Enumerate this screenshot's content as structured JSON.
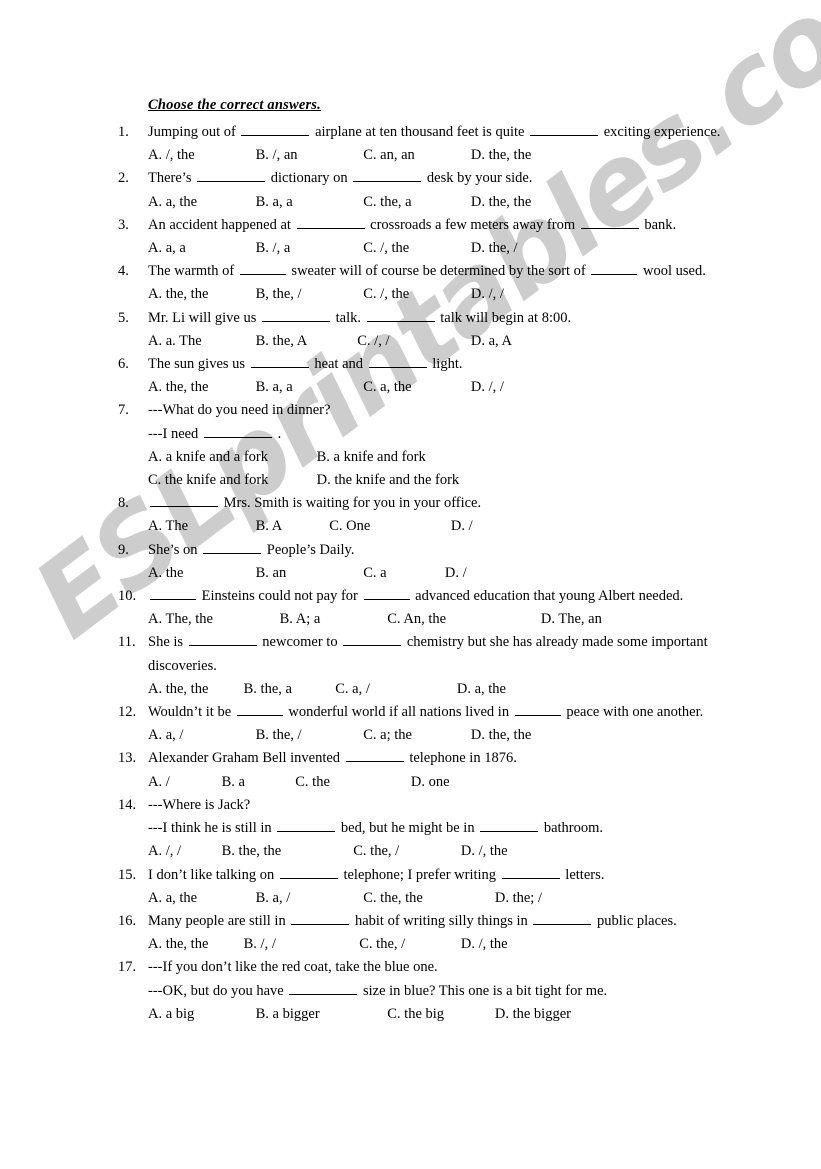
{
  "watermark": {
    "text": "ESLprintables.com",
    "color": "#c9c9c9"
  },
  "worksheet": {
    "title": "Choose the correct answers.",
    "questions": [
      {
        "num": "1.",
        "lines": [
          "Jumping out of",
          "airplane at ten thousand feet is quite",
          "exciting experience."
        ],
        "options": [
          "A. /, the",
          "B. /, an",
          "C. an, an",
          "D. the, the"
        ]
      },
      {
        "num": "2.",
        "lines": [
          "There’s",
          "dictionary on",
          "desk by your side."
        ],
        "options": [
          "A. a, the",
          "B. a, a",
          "C. the, a",
          "D. the, the"
        ]
      },
      {
        "num": "3.",
        "lines": [
          "An accident happened at",
          "crossroads a few meters away from",
          "bank."
        ],
        "options": [
          "A. a, a",
          "B. /, a",
          "C. /, the",
          "D. the, /"
        ]
      },
      {
        "num": "4.",
        "lines": [
          "The warmth of",
          "sweater will of course be determined by the sort of",
          "wool used."
        ],
        "options": [
          "A. the, the",
          "B, the, /",
          "C. /, the",
          "D. /, /"
        ]
      },
      {
        "num": "5.",
        "lines": [
          "Mr. Li will give us",
          "talk.",
          "talk will begin at 8:00."
        ],
        "options": [
          "A. a. The",
          "B. the, A",
          "C. /, /",
          "D. a, A"
        ]
      },
      {
        "num": "6.",
        "lines": [
          "The sun gives us",
          "heat and",
          "light."
        ],
        "options": [
          "A. the, the",
          "B. a, a",
          "C. a, the",
          "D. /, /"
        ]
      },
      {
        "num": "7.",
        "dialogue_1": "---What do you need in dinner?",
        "dialogue_2_pre": "---I need",
        "dialogue_2_post": ".",
        "options_row1": [
          "A. a knife and a fork",
          "B. a knife and fork"
        ],
        "options_row2": [
          "C. the knife and fork",
          "D. the knife and the fork"
        ]
      },
      {
        "num": "8.",
        "lines": [
          "",
          "Mrs. Smith is waiting for you in your office."
        ],
        "options": [
          "A. The",
          "B. A",
          "C. One",
          "D. /"
        ]
      },
      {
        "num": "9.",
        "lines": [
          "She’s on",
          "People’s Daily."
        ],
        "options": [
          "A. the",
          "B. an",
          "C. a",
          "D. /"
        ]
      },
      {
        "num": "10.",
        "lines": [
          "",
          "Einsteins could not pay for",
          "advanced education that young Albert needed."
        ],
        "options": [
          "A. The, the",
          "B. A; a",
          "C. An, the",
          "D. The, an"
        ]
      },
      {
        "num": "11.",
        "lines": [
          "She is",
          "newcomer to",
          "chemistry but she has already made some important"
        ],
        "line2": "discoveries.",
        "options": [
          "A. the, the",
          "B. the, a",
          "C. a, /",
          "D. a, the"
        ]
      },
      {
        "num": "12.",
        "lines": [
          "Wouldn’t it be",
          "wonderful world if all nations lived in",
          "peace with one another."
        ],
        "options": [
          "A. a, /",
          "B. the, /",
          "C. a; the",
          "D. the, the"
        ]
      },
      {
        "num": "13.",
        "lines": [
          "Alexander Graham Bell invented",
          "telephone in 1876."
        ],
        "options": [
          "A. /",
          "B. a",
          "C. the",
          "D. one"
        ]
      },
      {
        "num": "14.",
        "dialogue_1": "---Where is Jack?",
        "dialogue_2": [
          "---I think he is still in",
          "bed, but he might be in",
          "bathroom."
        ],
        "options": [
          "A. /, /",
          "B. the, the",
          "C. the, /",
          "D. /, the"
        ]
      },
      {
        "num": "15.",
        "lines": [
          "I don’t like talking on",
          "telephone; I prefer writing",
          "letters."
        ],
        "options": [
          "A. a, the",
          "B. a, /",
          "C. the, the",
          "D. the; /"
        ]
      },
      {
        "num": "16.",
        "lines": [
          "Many people are still in",
          "habit of writing silly things in",
          "public places."
        ],
        "options": [
          "A. the, the",
          "B. /, /",
          "C. the, /",
          "D. /, the"
        ]
      },
      {
        "num": "17.",
        "dialogue_1": "---If you don’t like the red coat, take the blue one.",
        "dialogue_2": [
          "---OK, but do you have",
          "size in blue? This one is a bit tight for me."
        ],
        "options": [
          "A. a big",
          "B. a bigger",
          "C. the big",
          "D. the bigger"
        ]
      }
    ]
  }
}
